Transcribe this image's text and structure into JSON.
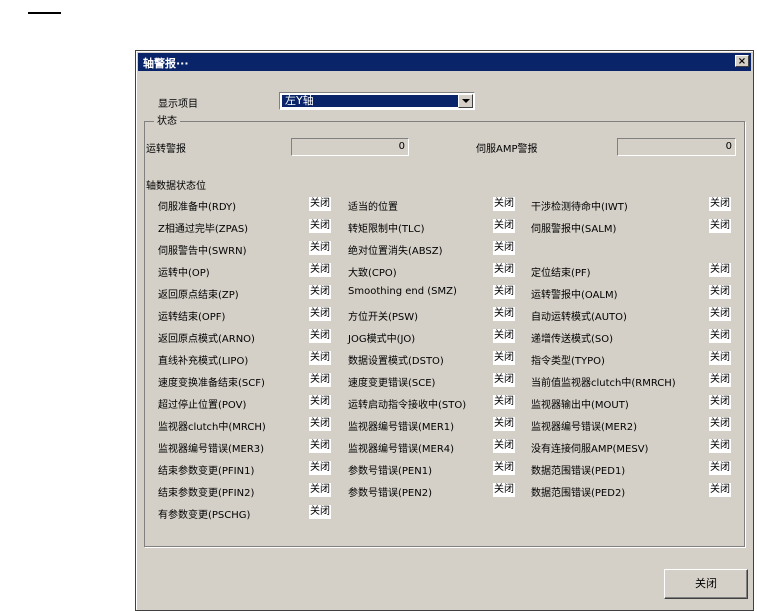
{
  "dialog": {
    "title": "轴警报···",
    "close_icon": "×",
    "ok_label": "关闭"
  },
  "display": {
    "label": "显示项目",
    "selected": "左Y轴"
  },
  "status": {
    "group_label": "状态",
    "running_alarm_label": "运转警报",
    "running_alarm_value": "0",
    "servo_amp_alarm_label": "伺服AMP警报",
    "servo_amp_alarm_value": "0",
    "axis_state_label": "轴数据状态位"
  },
  "rows": [
    [
      "伺服准备中(RDY)",
      "关闭",
      "适当的位置",
      "关闭",
      "干涉检测待命中(IWT)",
      "关闭"
    ],
    [
      "Z相通过完毕(ZPAS)",
      "关闭",
      "转矩限制中(TLC)",
      "关闭",
      "伺服警报中(SALM)",
      "关闭"
    ],
    [
      "伺服警告中(SWRN)",
      "关闭",
      "绝对位置消失(ABSZ)",
      "关闭",
      "",
      ""
    ],
    [
      "运转中(OP)",
      "关闭",
      "大致(CPO)",
      "关闭",
      "定位结束(PF)",
      "关闭"
    ],
    [
      "返回原点结束(ZP)",
      "关闭",
      "Smoothing end (SMZ)",
      "关闭",
      "运转警报中(OALM)",
      "关闭"
    ],
    [
      "运转结束(OPF)",
      "关闭",
      "方位开关(PSW)",
      "关闭",
      "自动运转模式(AUTO)",
      "关闭"
    ],
    [
      "返回原点模式(ARNO)",
      "关闭",
      "JOG模式中(JO)",
      "关闭",
      "递增传送模式(SO)",
      "关闭"
    ],
    [
      "直线补充模式(LIPO)",
      "关闭",
      "数据设置模式(DSTO)",
      "关闭",
      "指令类型(TYPO)",
      "关闭"
    ],
    [
      "速度变换准备结束(SCF)",
      "关闭",
      "速度变更错误(SCE)",
      "关闭",
      "当前值监视器clutch中(RMRCH)",
      "关闭"
    ],
    [
      "超过停止位置(POV)",
      "关闭",
      "运转启动指令接收中(STO)",
      "关闭",
      "监视器输出中(MOUT)",
      "关闭"
    ],
    [
      "监视器clutch中(MRCH)",
      "关闭",
      "监视器编号错误(MER1)",
      "关闭",
      "监视器编号错误(MER2)",
      "关闭"
    ],
    [
      "监视器编号错误(MER3)",
      "关闭",
      "监视器编号错误(MER4)",
      "关闭",
      "没有连接伺服AMP(MESV)",
      "关闭"
    ],
    [
      "结束参数变更(PFIN1)",
      "关闭",
      "参数号错误(PEN1)",
      "关闭",
      "数据范围错误(PED1)",
      "关闭"
    ],
    [
      "结束参数变更(PFIN2)",
      "关闭",
      "参数号错误(PEN2)",
      "关闭",
      "数据范围错误(PED2)",
      "关闭"
    ],
    [
      "有参数变更(PSCHG)",
      "关闭",
      "",
      "",
      "",
      ""
    ]
  ]
}
